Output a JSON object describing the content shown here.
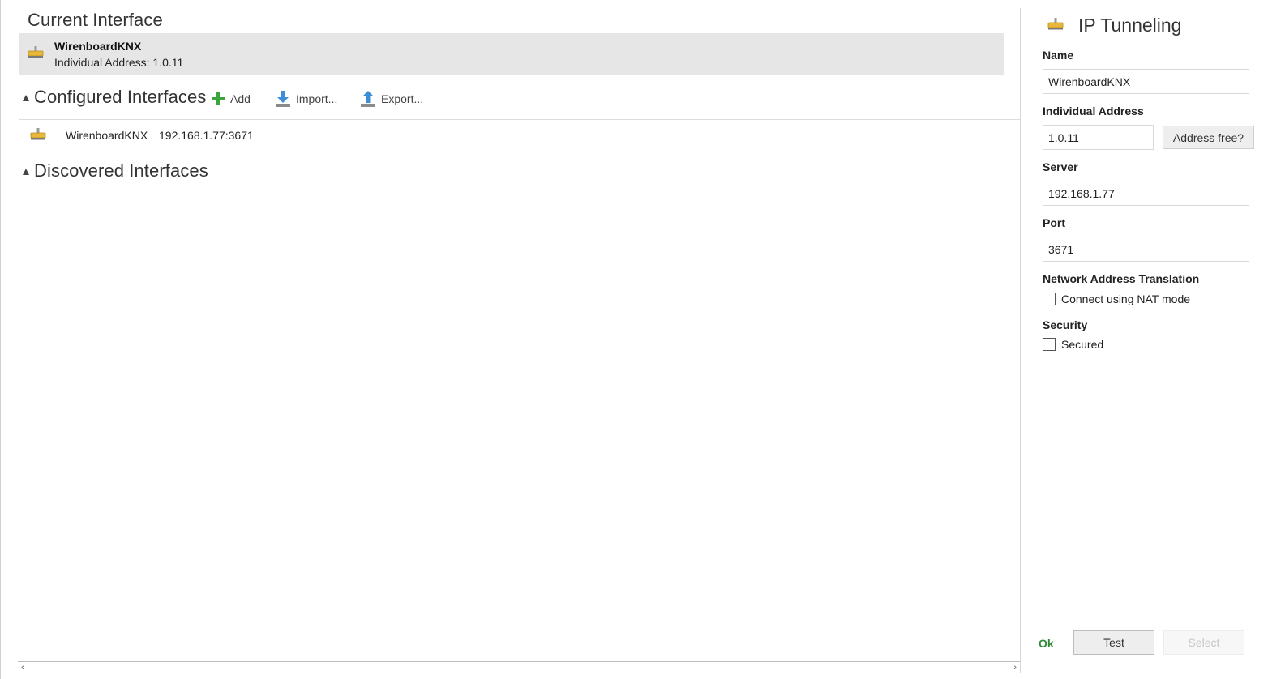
{
  "current_interface": {
    "title": "Current Interface",
    "name": "WirenboardKNX",
    "address_line": "Individual Address: 1.0.11",
    "icon": "network-interface-icon"
  },
  "configured_interfaces": {
    "title": "Configured Interfaces",
    "toolbar": {
      "add_label": "Add",
      "import_label": "Import...",
      "export_label": "Export..."
    },
    "items": [
      {
        "name": "WirenboardKNX",
        "endpoint": "192.168.1.77:3671",
        "icon": "network-interface-icon"
      }
    ]
  },
  "discovered_interfaces": {
    "title": "Discovered Interfaces",
    "items": []
  },
  "panel": {
    "title": "IP Tunneling",
    "icon": "network-interface-icon",
    "name_label": "Name",
    "name_value": "WirenboardKNX",
    "individual_address_label": "Individual Address",
    "individual_address_value": "1.0.11",
    "address_free_button": "Address free?",
    "server_label": "Server",
    "server_value": "192.168.1.77",
    "port_label": "Port",
    "port_value": "3671",
    "nat_label": "Network Address Translation",
    "nat_checkbox_label": "Connect using NAT mode",
    "nat_checked": false,
    "security_label": "Security",
    "secured_checkbox_label": "Secured",
    "secured_checked": false,
    "status_text": "Ok",
    "test_button": "Test",
    "select_button": "Select"
  },
  "colors": {
    "selected_row_bg": "#e6e6e6",
    "ok_green": "#2e8b3a",
    "add_green": "#3aa53a",
    "import_export_blue": "#3c8fd6",
    "icon_yellow": "#e8b83a"
  }
}
